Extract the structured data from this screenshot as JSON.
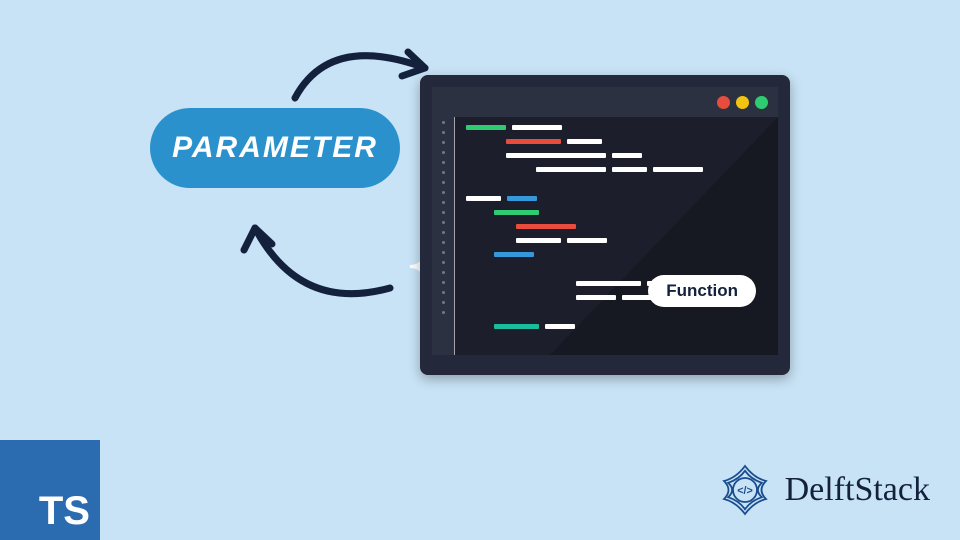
{
  "pill_label": "PARAMETER",
  "editor": {
    "function_label": "Function",
    "window_buttons": [
      "close",
      "minimize",
      "maximize"
    ]
  },
  "ts_badge": "TS",
  "brand": {
    "name": "DelftStack",
    "icon": "code-mandala-icon"
  },
  "colors": {
    "bg": "#c8e3f6",
    "pill": "#2b91cc",
    "navy": "#14213d",
    "editor_frame": "#23283a",
    "editor_body": "#1c1f2b"
  },
  "arrows": [
    "parameter-to-editor",
    "editor-to-parameter"
  ]
}
